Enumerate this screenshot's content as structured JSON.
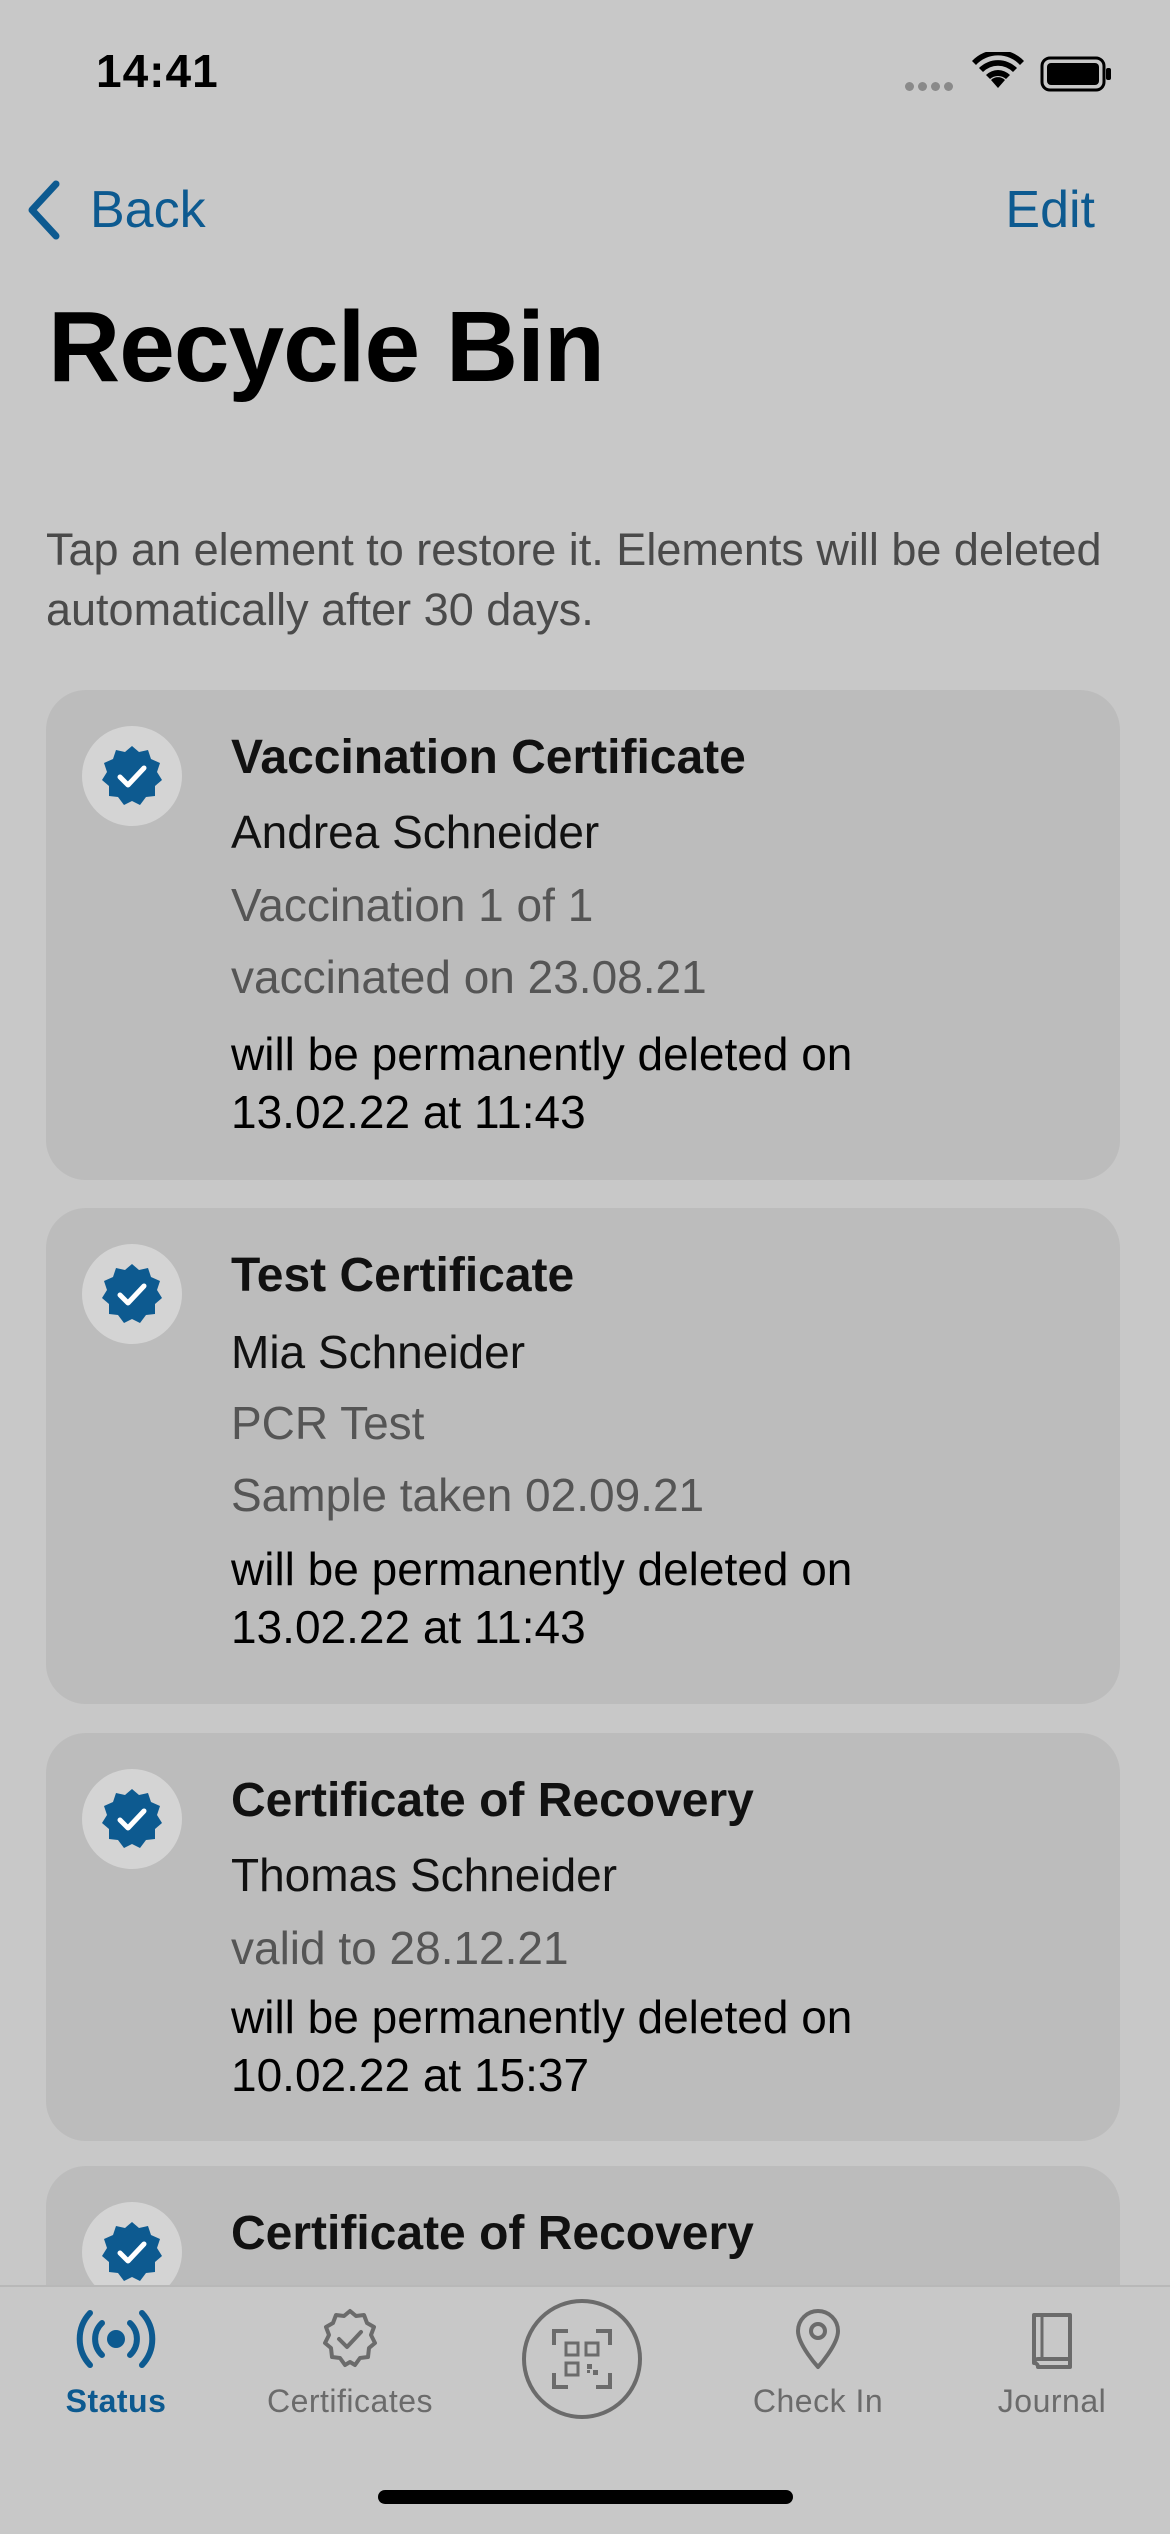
{
  "status_bar": {
    "time": "14:41"
  },
  "nav": {
    "back_label": "Back",
    "edit_label": "Edit"
  },
  "page": {
    "title": "Recycle Bin",
    "intro": "Tap an element to restore it. Elements will be deleted automatically after 30 days."
  },
  "cards": [
    {
      "type": "Vaccination Certificate",
      "name": "Andrea Schneider",
      "detail1": "Vaccination 1 of 1",
      "detail2": "vaccinated on 23.08.21",
      "deletion_line1": "will be permanently deleted on",
      "deletion_line2": "13.02.22 at 11:43"
    },
    {
      "type": "Test Certificate",
      "name": "Mia Schneider",
      "detail1": "PCR Test",
      "detail2": "Sample taken 02.09.21",
      "deletion_line1": "will be permanently deleted on",
      "deletion_line2": "13.02.22 at 11:43"
    },
    {
      "type": "Certificate of Recovery",
      "name": "Thomas Schneider",
      "detail1": "valid to 28.12.21",
      "deletion_line1": "will be permanently deleted on",
      "deletion_line2": "10.02.22 at 15:37"
    },
    {
      "type": "Certificate of Recovery"
    }
  ],
  "tabbar": {
    "status": "Status",
    "certificates": "Certificates",
    "check_in": "Check In",
    "journal": "Journal"
  },
  "colors": {
    "accent": "#0d5a90",
    "background": "#c8c8c8",
    "card": "#bcbcbc"
  },
  "icons": {
    "card": "verified-badge-icon",
    "back": "chevron-left-icon",
    "status_tab": "broadcast-icon",
    "certificates_tab": "badge-check-outline-icon",
    "scan_tab": "qr-code-scan-icon",
    "check_in_tab": "map-pin-icon",
    "journal_tab": "book-icon"
  }
}
